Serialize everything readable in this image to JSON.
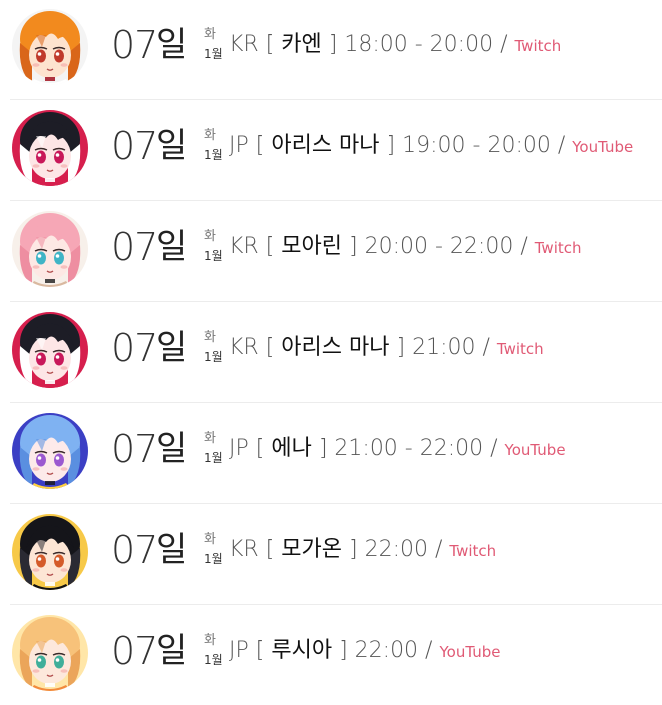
{
  "schedule": [
    {
      "day": "07",
      "day_suffix": "일",
      "weekday": "화",
      "month": "1월",
      "region": "KR",
      "name": "카엔",
      "time": "18:00 - 20:00",
      "platform": "Twitch",
      "avatar": {
        "icon": "avatar-kaen",
        "bg": "#f4f4f4",
        "hair": "#f28a1e",
        "hair_dark": "#d9661a",
        "skin": "#fde3cf",
        "eye": "#c0392b",
        "accent": "#ffffff",
        "accent2": "#a61f2c"
      }
    },
    {
      "day": "07",
      "day_suffix": "일",
      "weekday": "화",
      "month": "1월",
      "region": "JP",
      "name": "아리스 마나",
      "time": "19:00 - 20:00",
      "platform": "YouTube",
      "avatar": {
        "icon": "avatar-aris-mana",
        "bg": "#d61f4d",
        "hair": "#1d1d26",
        "hair_dark": "#ffffff",
        "skin": "#fde6e6",
        "eye": "#c8185a",
        "accent": "#d61f4d",
        "accent2": "#ffffff"
      }
    },
    {
      "day": "07",
      "day_suffix": "일",
      "weekday": "화",
      "month": "1월",
      "region": "KR",
      "name": "모아린",
      "time": "20:00 - 22:00",
      "platform": "Twitch",
      "avatar": {
        "icon": "avatar-moarin",
        "bg": "#f7f0ea",
        "hair": "#f6a7b6",
        "hair_dark": "#ee8ea1",
        "skin": "#fde8e4",
        "eye": "#3fb4c6",
        "accent": "#d9b9a0",
        "accent2": "#333333"
      }
    },
    {
      "day": "07",
      "day_suffix": "일",
      "weekday": "화",
      "month": "1월",
      "region": "KR",
      "name": "아리스 마나",
      "time": "21:00",
      "platform": "Twitch",
      "avatar": {
        "icon": "avatar-aris-mana",
        "bg": "#d61f4d",
        "hair": "#1d1d26",
        "hair_dark": "#ffffff",
        "skin": "#fde6e6",
        "eye": "#c8185a",
        "accent": "#d61f4d",
        "accent2": "#ffffff"
      }
    },
    {
      "day": "07",
      "day_suffix": "일",
      "weekday": "화",
      "month": "1월",
      "region": "JP",
      "name": "에나",
      "time": "21:00 - 22:00",
      "platform": "YouTube",
      "avatar": {
        "icon": "avatar-ena",
        "bg": "#3b3fc4",
        "hair": "#7fb2f2",
        "hair_dark": "#5a8fe0",
        "skin": "#fdeaea",
        "eye": "#9b59d0",
        "accent": "#ffd23f",
        "accent2": "#1c1c2c"
      }
    },
    {
      "day": "07",
      "day_suffix": "일",
      "weekday": "화",
      "month": "1월",
      "region": "KR",
      "name": "모가온",
      "time": "22:00",
      "platform": "Twitch",
      "avatar": {
        "icon": "avatar-mogaon",
        "bg": "#f7c948",
        "hair": "#15151a",
        "hair_dark": "#2a2a33",
        "skin": "#fde6d5",
        "eye": "#d45b2a",
        "accent": "#111111",
        "accent2": "#ffffff"
      }
    },
    {
      "day": "07",
      "day_suffix": "일",
      "weekday": "화",
      "month": "1월",
      "region": "JP",
      "name": "루시아",
      "time": "22:00",
      "platform": "YouTube",
      "avatar": {
        "icon": "avatar-lucia",
        "bg": "#ffe6a8",
        "hair": "#f7c27a",
        "hair_dark": "#eba55a",
        "skin": "#fde8dc",
        "eye": "#3fae9a",
        "accent": "#f28a3c",
        "accent2": "#ffffff"
      }
    }
  ]
}
